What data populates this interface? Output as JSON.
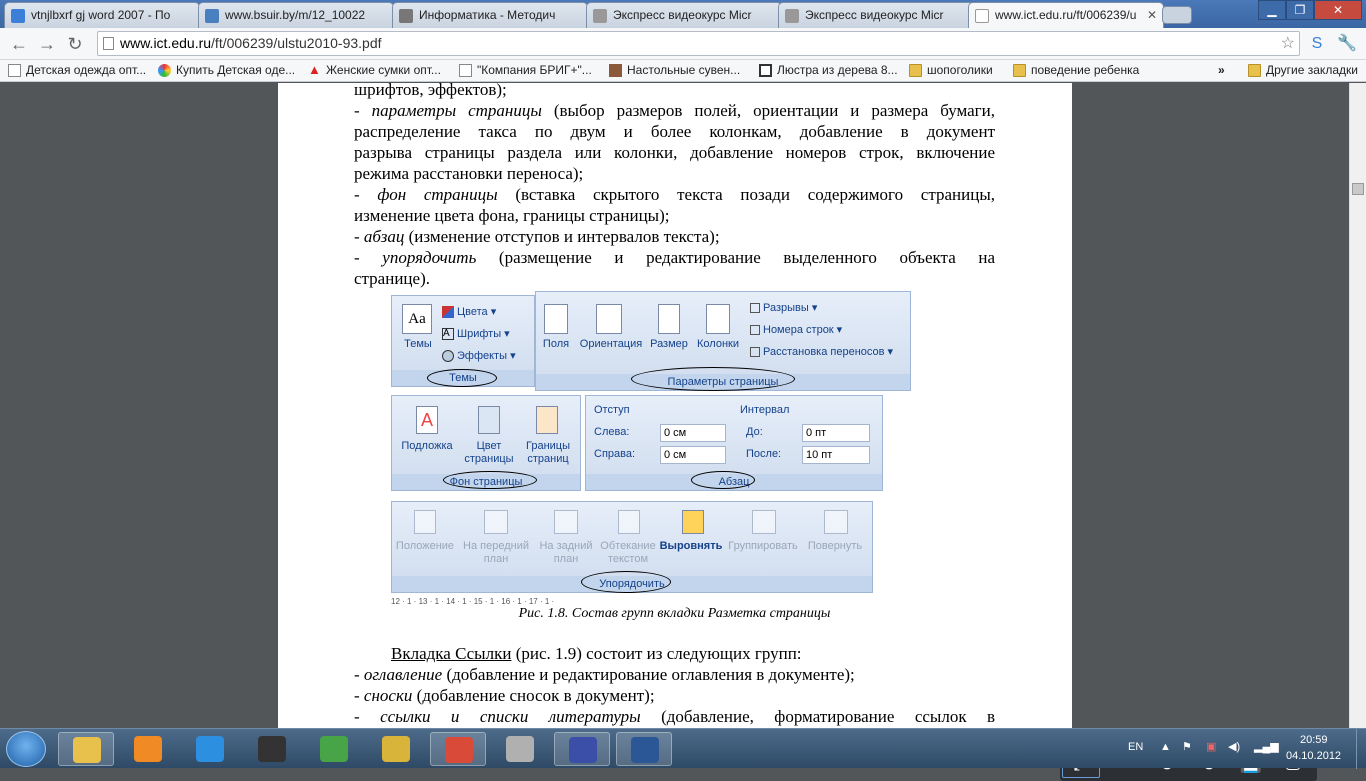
{
  "browser": {
    "tabs": [
      {
        "title": "vtnjlbxrf gj word 2007 - По",
        "icon_color": "#3b7fd8"
      },
      {
        "title": "www.bsuir.by/m/12_10022",
        "icon_color": "#4a7fc0"
      },
      {
        "title": "Информатика - Методич",
        "icon_color": "#777777"
      },
      {
        "title": "Экспресс видеокурс Micr",
        "icon_color": "#999999"
      },
      {
        "title": "Экспресс видеокурс Micr",
        "icon_color": "#999999"
      },
      {
        "title": "www.ict.edu.ru/ft/006239/u",
        "icon_color": "#cccccc",
        "active": true
      }
    ],
    "address": {
      "domain": "www.ict.edu.ru",
      "path": "/ft/006239/ulstu2010-93.pdf"
    },
    "bookmarks": [
      {
        "label": "Детская одежда опт...",
        "icon": "page-icon"
      },
      {
        "label": "Купить Детская оде...",
        "icon": "colorful-icon"
      },
      {
        "label": "Женские сумки опт...",
        "icon": "warning-icon"
      },
      {
        "label": "\"Компания БРИГ+\"...",
        "icon": "page-icon"
      },
      {
        "label": "Настольные сувен...",
        "icon": "image-icon"
      },
      {
        "label": "Люстра из дерева 8...",
        "icon": "grid-icon"
      },
      {
        "label": "шопоголики",
        "icon": "folder-icon"
      },
      {
        "label": "поведение ребенка",
        "icon": "folder-icon"
      }
    ],
    "bookmarks_overflow": "»",
    "other_bookmarks": "Другие закладки"
  },
  "document": {
    "lines": [
      {
        "parts": [
          {
            "t": "шрифтов, эффектов);"
          }
        ],
        "justify": false
      },
      {
        "parts": [
          {
            "t": "- "
          },
          {
            "t": "параметры страницы",
            "i": true
          },
          {
            "t": " (выбор размеров полей, ориентации и размера бумаги,"
          }
        ],
        "justify": true
      },
      {
        "parts": [
          {
            "t": "распределение такса по двум и более колонкам, добавление в документ"
          }
        ],
        "justify": true
      },
      {
        "parts": [
          {
            "t": "разрыва страницы раздела или колонки, добавление номеров строк, включение"
          }
        ],
        "justify": true
      },
      {
        "parts": [
          {
            "t": "режима расстановки переноса);"
          }
        ],
        "justify": false
      },
      {
        "parts": [
          {
            "t": "- "
          },
          {
            "t": "фон страницы",
            "i": true
          },
          {
            "t": " (вставка скрытого текста позади содержимого страницы,"
          }
        ],
        "justify": true
      },
      {
        "parts": [
          {
            "t": "изменение цвета фона, границы страницы);"
          }
        ],
        "justify": false
      },
      {
        "parts": [
          {
            "t": "- "
          },
          {
            "t": "абзац",
            "i": true
          },
          {
            "t": " (изменение отступов и интервалов текста);"
          }
        ],
        "justify": false
      },
      {
        "parts": [
          {
            "t": "- "
          },
          {
            "t": "упорядочить",
            "i": true
          },
          {
            "t": " (размещение и редактирование выделенного объекта на"
          }
        ],
        "justify": true
      },
      {
        "parts": [
          {
            "t": "странице)."
          }
        ],
        "justify": false
      }
    ],
    "figure_caption": "Рис. 1.8. Состав групп вкладки Разметка страницы",
    "after_lines": [
      {
        "parts": [
          {
            "t": "Вкладка Ссылки",
            "u": true
          },
          {
            "t": " (рис. 1.9)  состоит из следующих групп:"
          }
        ],
        "justify": false,
        "indent": true
      },
      {
        "parts": [
          {
            "t": "- "
          },
          {
            "t": "оглавление",
            "i": true
          },
          {
            "t": " (добавление и редактирование оглавления в документе);"
          }
        ],
        "justify": false
      },
      {
        "parts": [
          {
            "t": "- "
          },
          {
            "t": "сноски",
            "i": true
          },
          {
            "t": " (добавление сносок в документ);"
          }
        ],
        "justify": false
      },
      {
        "parts": [
          {
            "t": "- "
          },
          {
            "t": "ссылки и списки литературы",
            "i": true
          },
          {
            "t": " (добавление,  форматирование ссылок в"
          }
        ],
        "justify": true
      }
    ]
  },
  "ribbon": {
    "themes": {
      "button": "Темы",
      "colors": "Цвета",
      "fonts": "Шрифты",
      "effects": "Эффекты",
      "group": "Темы"
    },
    "page_setup": {
      "margins": "Поля",
      "orientation": "Ориентация",
      "size": "Размер",
      "columns": "Колонки",
      "breaks": "Разрывы",
      "line_numbers": "Номера строк",
      "hyphenation": "Расстановка переносов",
      "group": "Параметры страницы"
    },
    "background": {
      "watermark": "Подложка",
      "color_1": "Цвет",
      "color_2": "страницы",
      "borders_1": "Границы",
      "borders_2": "страниц",
      "group": "Фон страницы"
    },
    "paragraph": {
      "indent": "Отступ",
      "left": "Слева:",
      "left_val": "0 см",
      "right": "Справа:",
      "right_val": "0 см",
      "spacing": "Интервал",
      "before": "До:",
      "before_val": "0 пт",
      "after": "После:",
      "after_val": "10 пт",
      "group": "Абзац"
    },
    "arrange": {
      "position": "Положение",
      "front_1": "На передний",
      "front_2": "план",
      "back_1": "На задний",
      "back_2": "план",
      "wrap_1": "Обтекание",
      "wrap_2": "текстом",
      "align": "Выровнять",
      "group_btn": "Группировать",
      "rotate": "Повернуть",
      "group": "Упорядочить"
    },
    "ruler": "12 · 1 · 13 · 1 · 14 · 1 · 15 · 1 · 16 · 1 · 17 · 1 ·"
  },
  "taskbar": {
    "apps": [
      {
        "name": "file-explorer-icon",
        "color": "#e8c14c"
      },
      {
        "name": "media-player-icon",
        "color": "#f08a24"
      },
      {
        "name": "internet-explorer-icon",
        "color": "#2c8fe0"
      },
      {
        "name": "scanner-icon",
        "color": "#333333"
      },
      {
        "name": "utorrent-icon",
        "color": "#47a447"
      },
      {
        "name": "cd-burner-icon",
        "color": "#d8b43a"
      },
      {
        "name": "chrome-icon",
        "color": "#d94a38"
      },
      {
        "name": "webcam-icon",
        "color": "#b0b0b0"
      },
      {
        "name": "floppy-icon",
        "color": "#3b4fa8"
      },
      {
        "name": "word-icon",
        "color": "#2b5797"
      }
    ],
    "lang": "EN",
    "time": "20:59",
    "date": "04.10.2012"
  }
}
